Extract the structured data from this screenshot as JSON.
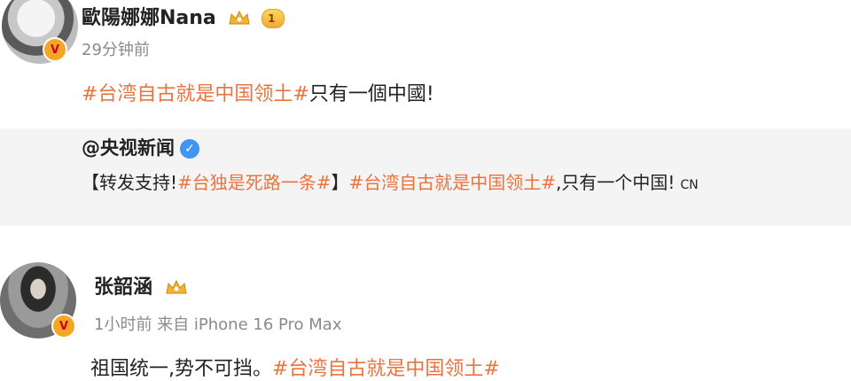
{
  "post1": {
    "author": "歐陽娜娜Nana",
    "level": "1",
    "time": "29分钟前",
    "text_tag": "#台湾自古就是中国领土#",
    "text_rest": "只有一個中國!"
  },
  "repost": {
    "author": "@央视新闻",
    "text_part1": "【转发支持!",
    "text_tag1": "#台独是死路一条#",
    "text_part2": "】",
    "text_tag2": "#台湾自古就是中国领土#",
    "text_part3": ",只有一个中国!",
    "text_suffix": "CN"
  },
  "post2": {
    "author": "张韶涵",
    "time": "1小时前  来自 iPhone 16 Pro Max",
    "text_rest": "祖国统一,势不可挡。",
    "text_tag": "#台湾自古就是中国领土#"
  },
  "colors": {
    "tag": "#eb7340",
    "verified_badge": "#f5a623",
    "blue_v": "#3f95f0",
    "repost_bg": "#f4f4f4"
  }
}
